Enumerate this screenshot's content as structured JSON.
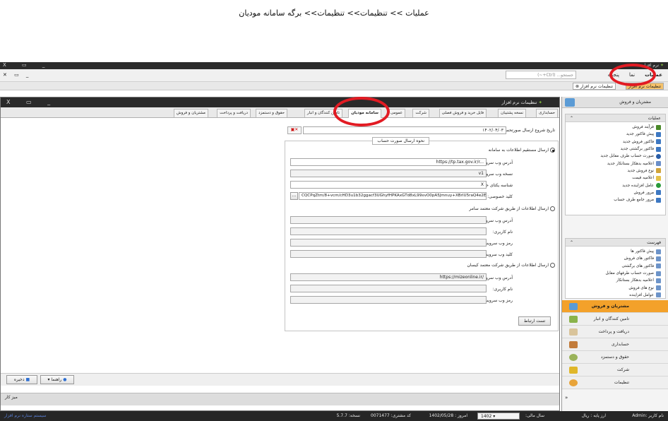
{
  "caption": "عملیات >> تنظیمات>> تنظیمات>> برگه سامانه مودیان",
  "app_title": "نرم افزار",
  "window_controls": "X ▭ _",
  "mdi_controls": "X ▭ _",
  "menubar": {
    "items": [
      "عملیات",
      "نما",
      "پنجره"
    ],
    "search_placeholder": "جستجو... (Ctrl+~)"
  },
  "doc_tabs": [
    "تنظیمات نرم افزار",
    "تنظیمات نرم افزار"
  ],
  "settings_window": {
    "title": "تنظیمات نرم افزار",
    "tabs": [
      "حسابداری",
      "نسخه پشتیبان",
      "فایل خرید و فروش فصلی",
      "شرکت",
      "عمومی",
      "سامانه مودیان",
      "تامین کنندگان و انبار",
      "حقوق و دستمزد",
      "دریافت و پرداخت",
      "مشتریان و فروش"
    ],
    "active_tab": "سامانه مودیان"
  },
  "form": {
    "start_date_label": "تاریخ شروع ارسال صورتحساب:",
    "start_date_value": "۱۴۰۲/۰۴/۰۳",
    "group_title": "نحوه ارسال صورت حساب",
    "opt1_label": "ارسال مستقیم اطلاعات به سامانه",
    "opt1_selected": true,
    "url_label": "آدرس وب سرویس:",
    "url_value": "https://tp.tax.gov.ir/r...",
    "version_label": "نسخه وب سرویس:",
    "version_value": "v1",
    "memory_id_label": "شناسه یکتای حافظه مالیاتی:",
    "memory_id_value": "X",
    "private_key_label": "کلید خصوصی:",
    "private_key_value": "CQCPqZtm/8+vcm/cHD3u1b32ggacf3UGhyfHPKAxGTd8xL99xvO0pA5Jmnuy+XBrlU5raQ4e2E",
    "browse_label": "...",
    "opt2_label": "ارسال اطلاعات از طریق شرکت معتمد سامر",
    "opt2_url_label": "آدرس وب سرویس:",
    "opt2_user_label": "نام کاربری:",
    "opt2_pass_label": "رمز وب سرویس:",
    "opt2_key_label": "کلید وب سرویس:",
    "opt3_label": "ارسال اطلاعات از طریق شرکت معتمد کیسان",
    "opt3_url_label": "آدرس وب سرویس:",
    "opt3_url_value": "https://mizeonline.ir/",
    "opt3_user_label": "نام کاربری:",
    "opt3_pass_label": "رمز وب سرویس:",
    "test_button": "تست ارتباط"
  },
  "bottom": {
    "save_label": "ذخیره",
    "help_label": "راهنما"
  },
  "inner_footer": "میز کار",
  "right_panel": {
    "title": "مشتریان و فروش",
    "ops_header": "عملیات",
    "ops_items": [
      "فرآیند فروش",
      "پیش فاکتور جدید",
      "فاکتور فروش جدید",
      "فاکتور برگشتی جدید",
      "صورت حساب طرف مقابل جدید",
      "اعلامیه بدهکار بستانکار جدید",
      "نوع فروش جدید",
      "اعلامیه قیمت",
      "عامل افزاینده جدید",
      "مرور فروش",
      "مرور جامع طرف حساب"
    ],
    "list_header": "فهرست",
    "list_items": [
      "پیش فاکتور ها",
      "فاکتور های فروش",
      "فاکتور های برگشتی",
      "صورت حساب طرفهای مقابل",
      "اعلامیه بدهکار بستانکار",
      "نوع های فروش",
      "عوامل افزاینده"
    ],
    "modules": [
      "مشتریان و فروش",
      "تامین کنندگان و انبار",
      "دریافت و پرداخت",
      "حسابداری",
      "حقوق و دستمزد",
      "شرکت",
      "تنظیمات"
    ],
    "active_module": "مشتریان و فروش"
  },
  "statusbar": {
    "user": "نام کاربر :Admin",
    "currency": "ارز پایه : ریال",
    "fiscal_year_label": "سال مالی:",
    "fiscal_year": "1402",
    "today": "امروز : 1402/05/28",
    "customer_code": "کد مشتری: 0071477",
    "version": "نسخه: 5.7.7",
    "left_text": "سیستم ستاره نرم افزار"
  },
  "colors": {
    "highlight_ring": "#e21b23",
    "active_module": "#f3a12a",
    "titlebar": "#2b2b2b"
  }
}
